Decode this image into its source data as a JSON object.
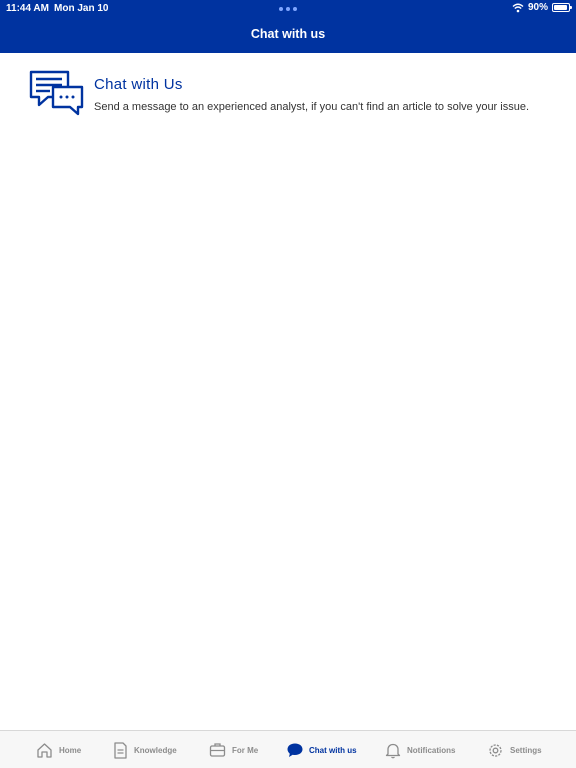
{
  "status_bar": {
    "time": "11:44 AM",
    "date": "Mon Jan 10",
    "battery": "90%",
    "battery_level": 0.9
  },
  "nav": {
    "title": "Chat with us"
  },
  "card": {
    "title": "Chat with Us",
    "description": "Send a message to an experienced analyst, if you can't find an article to solve your issue."
  },
  "tabs": [
    {
      "label": "Home",
      "icon": "home-icon",
      "active": false
    },
    {
      "label": "Knowledge",
      "icon": "document-icon",
      "active": false
    },
    {
      "label": "For Me",
      "icon": "briefcase-icon",
      "active": false
    },
    {
      "label": "Chat with us",
      "icon": "chat-bubble-icon",
      "active": true
    },
    {
      "label": "Notifications",
      "icon": "bell-icon",
      "active": false
    },
    {
      "label": "Settings",
      "icon": "gear-icon",
      "active": false
    }
  ],
  "colors": {
    "brand": "#0033a0",
    "inactive": "#8c8c8c"
  }
}
